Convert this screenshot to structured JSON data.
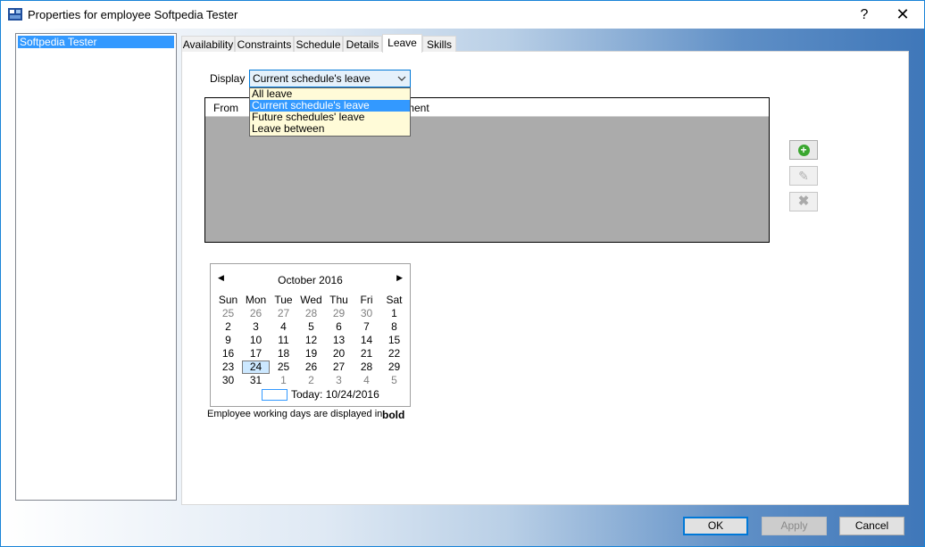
{
  "window": {
    "title": "Properties for employee Softpedia Tester",
    "help_glyph": "?",
    "close_glyph": "✕"
  },
  "employees": [
    "Softpedia Tester"
  ],
  "tabs": [
    "Availability",
    "Constraints",
    "Schedule",
    "Details",
    "Leave",
    "Skills"
  ],
  "active_tab": "Leave",
  "display": {
    "label": "Display",
    "selected": "Current schedule's leave",
    "options": [
      "All leave",
      "Current schedule's leave",
      "Future schedules' leave",
      "Leave between"
    ]
  },
  "grid": {
    "col_from": "From",
    "col_comment": "ment"
  },
  "calendar": {
    "title": "October 2016",
    "prev_glyph": "◀",
    "next_glyph": "▶",
    "day_names": [
      "Sun",
      "Mon",
      "Tue",
      "Wed",
      "Thu",
      "Fri",
      "Sat"
    ],
    "weeks": [
      [
        "25",
        "26",
        "27",
        "28",
        "29",
        "30",
        "1"
      ],
      [
        "2",
        "3",
        "4",
        "5",
        "6",
        "7",
        "8"
      ],
      [
        "9",
        "10",
        "11",
        "12",
        "13",
        "14",
        "15"
      ],
      [
        "16",
        "17",
        "18",
        "19",
        "20",
        "21",
        "22"
      ],
      [
        "23",
        "24",
        "25",
        "26",
        "27",
        "28",
        "29"
      ],
      [
        "30",
        "31",
        "1",
        "2",
        "3",
        "4",
        "5"
      ]
    ],
    "today_label": "Today: 10/24/2016"
  },
  "legend": {
    "text": "Employee working days are displayed in",
    "bold_word": "bold"
  },
  "buttons": {
    "ok": "OK",
    "apply": "Apply",
    "cancel": "Cancel"
  },
  "icons": {
    "add": "+",
    "edit": "✎",
    "delete": "✖"
  }
}
